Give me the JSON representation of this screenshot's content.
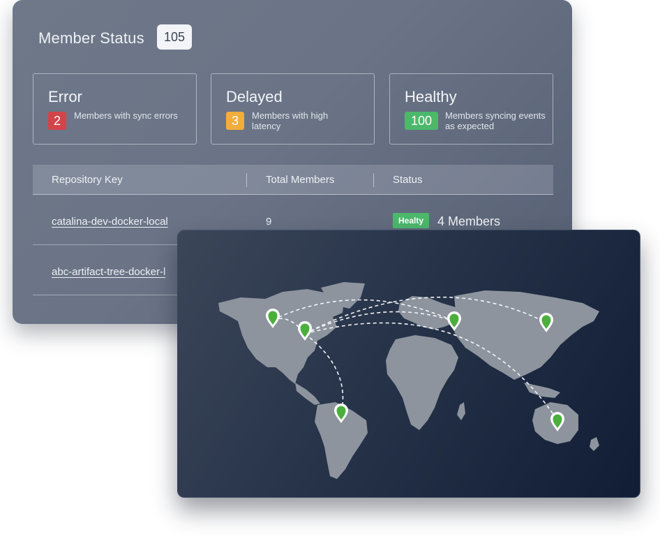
{
  "member_status": {
    "title": "Member Status",
    "total": "105",
    "cards": [
      {
        "title": "Error",
        "count": "2",
        "description": "Members with sync errors",
        "color": "#d2444a"
      },
      {
        "title": "Delayed",
        "count": "3",
        "description": "Members with high latency",
        "color": "#f2ad3c"
      },
      {
        "title": "Healthy",
        "count": "100",
        "description": "Members syncing events as expected",
        "color": "#4cb86c"
      }
    ],
    "table": {
      "columns": [
        "Repository Key",
        "Total Members",
        "Status"
      ],
      "rows": [
        {
          "key": "catalina-dev-docker-local",
          "total": "9",
          "status": "Healty",
          "members": "4 Members"
        },
        {
          "key": "abc-artifact-tree-docker-l",
          "total": "",
          "status": "",
          "members": ""
        }
      ]
    }
  },
  "map": {
    "pins": [
      "pin-north-america-west",
      "pin-north-america-east",
      "pin-south-america",
      "pin-europe",
      "pin-east-asia",
      "pin-australia"
    ],
    "pin_color": "#4caf3d",
    "land_color": "#8d949e"
  }
}
